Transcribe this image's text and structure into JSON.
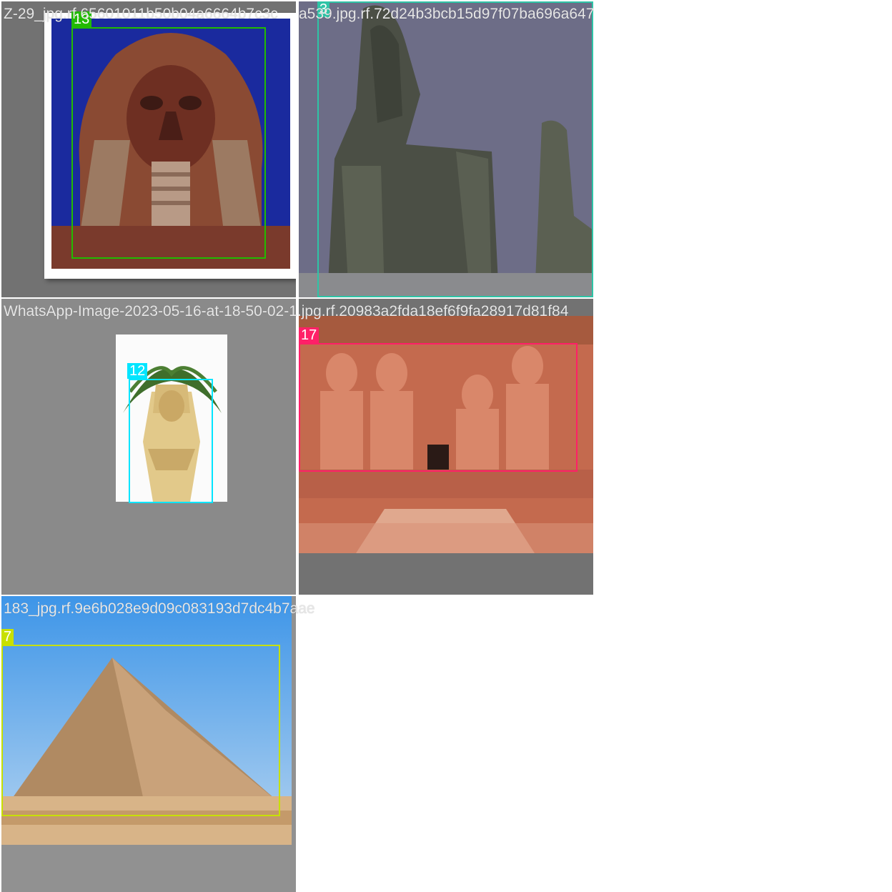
{
  "tiles": [
    {
      "filename": "Z-29_jpg.rf.65601011b50b04a6664b7c3c",
      "label": "13",
      "color": "#22bb00"
    },
    {
      "filename": "a539.jpg.rf.72d24b3bcb15d97f07ba696a647",
      "label": "3",
      "color": "#2ec4a6"
    },
    {
      "filename": "WhatsApp-Image-2023-05-16-at-18-50-02-1.jpg.rf.20983a2fda18ef6f9fa28917d81f84",
      "label": "12",
      "color": "#00e5ff"
    },
    {
      "filename": "",
      "label": "17",
      "color": "#ff2068"
    },
    {
      "filename": "183_jpg.rf.9e6b028e9d09c083193d7dc4b7aae",
      "label": "7",
      "color": "#c8e000"
    }
  ]
}
